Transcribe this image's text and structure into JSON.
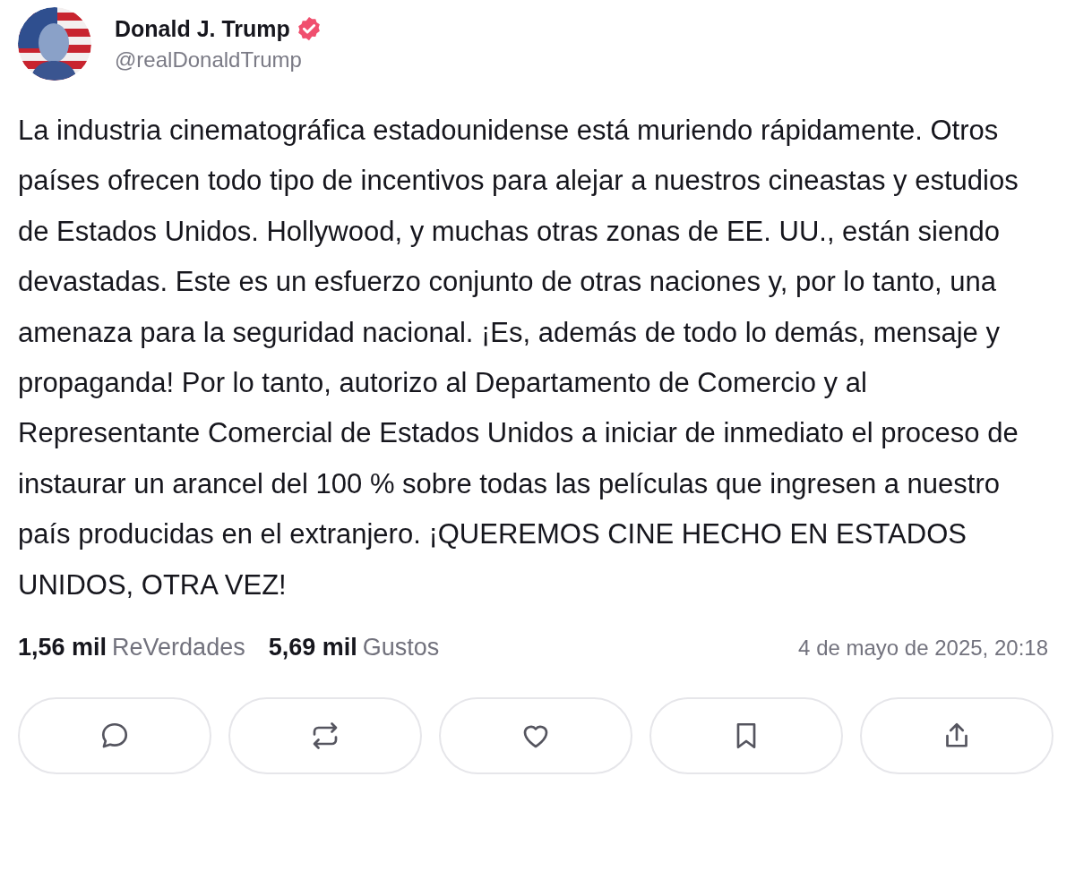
{
  "author": {
    "name": "Donald J. Trump",
    "verified": true,
    "handle": "@realDonaldTrump"
  },
  "body": "La industria cinematográfica estadounidense está muriendo rápidamente. Otros países ofrecen todo tipo de incentivos para alejar a nuestros cineastas y estudios de Estados Unidos. Hollywood, y muchas otras zonas de EE. UU., están siendo devastadas. Este es un esfuerzo conjunto de otras naciones y, por lo tanto, una amenaza para la seguridad nacional. ¡Es, además de todo lo demás, mensaje y propaganda! Por lo tanto, autorizo al Departamento de Comercio y al Representante Comercial de Estados Unidos a iniciar de inmediato el proceso de instaurar un arancel del 100 % sobre todas las películas que ingresen a nuestro país producidas en el extranjero. ¡QUEREMOS CINE HECHO EN ESTADOS UNIDOS, OTRA VEZ!",
  "stats": [
    {
      "count": "1,56 mil",
      "label": "ReVerdades"
    },
    {
      "count": "5,69 mil",
      "label": "Gustos"
    }
  ],
  "timestamp": "4 de mayo de 2025, 20:18",
  "actions": [
    {
      "kind": "reply"
    },
    {
      "kind": "repost"
    },
    {
      "kind": "like"
    },
    {
      "kind": "bookmark"
    },
    {
      "kind": "share"
    }
  ]
}
